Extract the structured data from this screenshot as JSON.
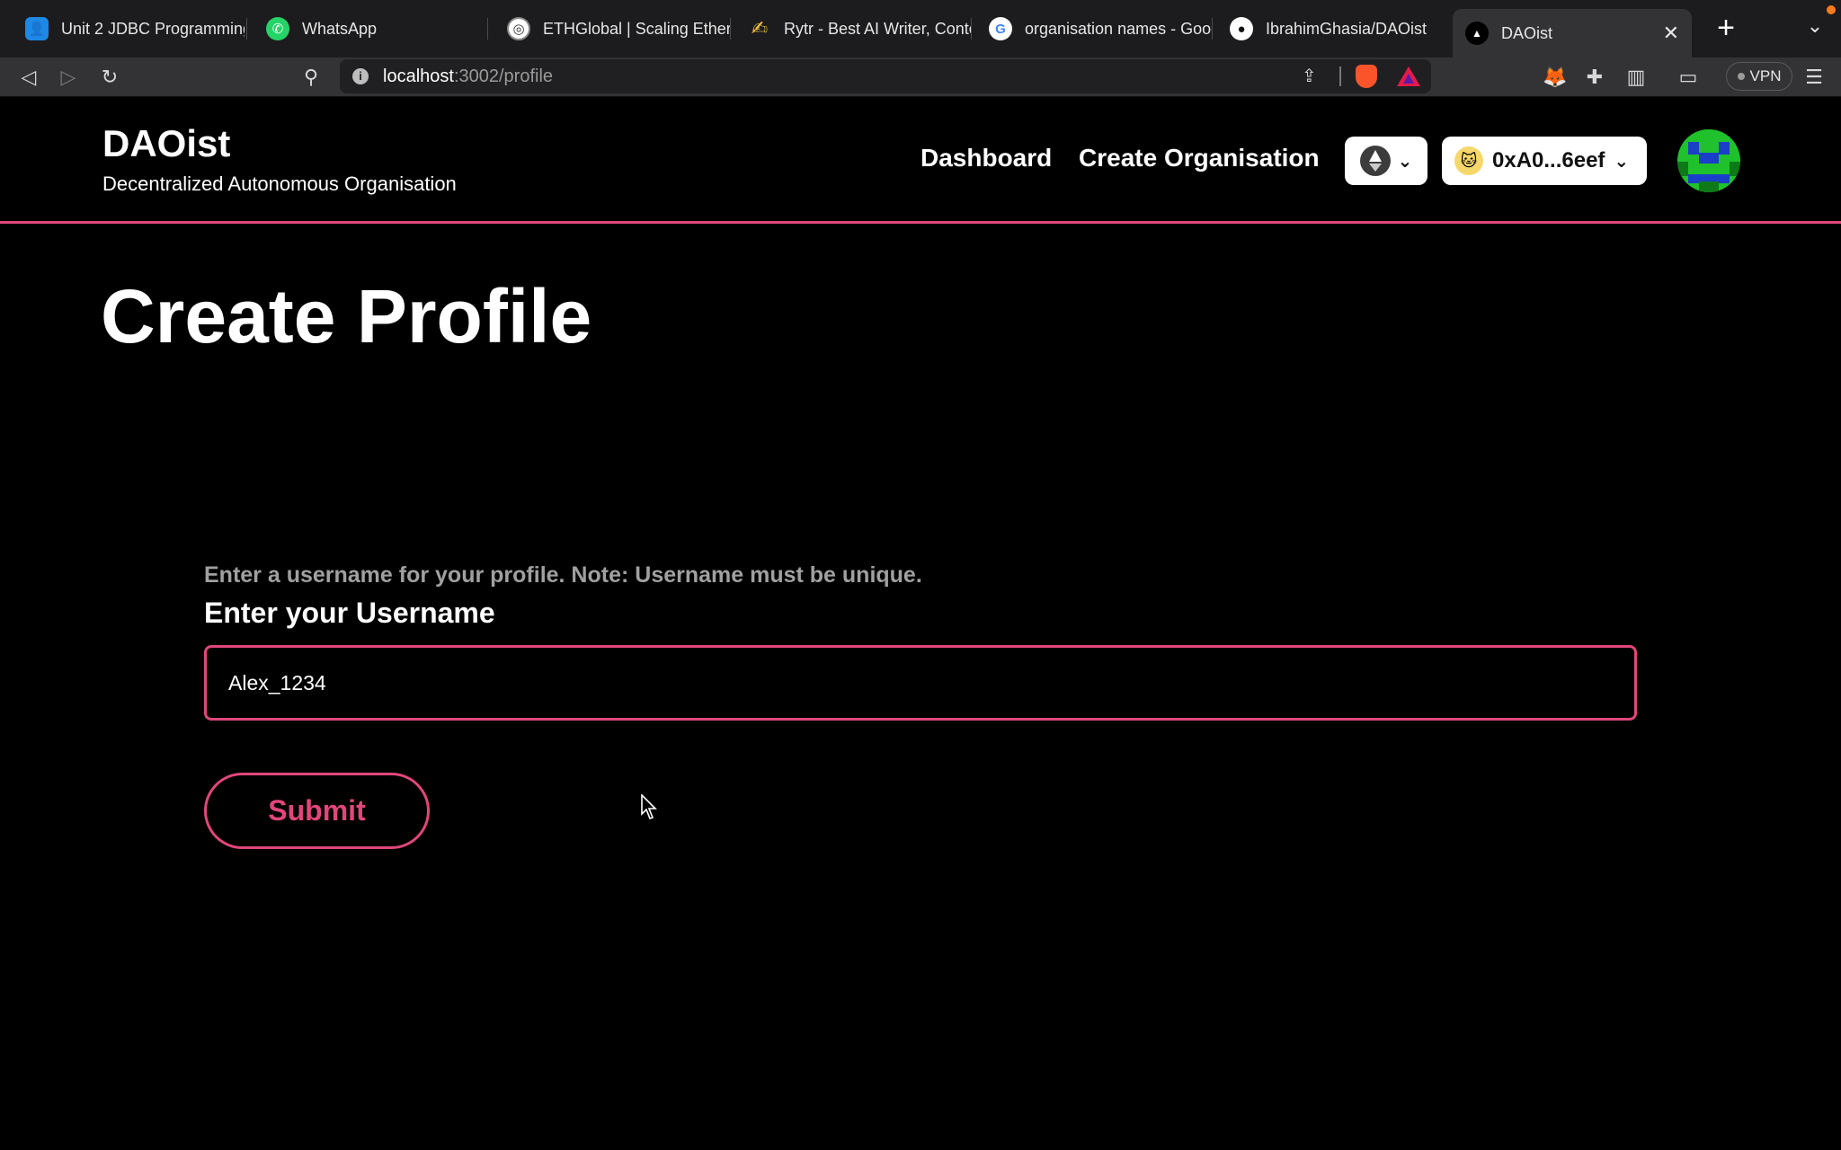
{
  "browser": {
    "tabs": [
      {
        "title": "Unit 2 JDBC Programming",
        "icon": "google-classroom-icon"
      },
      {
        "title": "WhatsApp",
        "icon": "whatsapp-icon"
      },
      {
        "title": "ETHGlobal | Scaling Ethere",
        "icon": "ethglobal-icon"
      },
      {
        "title": "Rytr - Best AI Writer, Conte",
        "icon": "rytr-icon"
      },
      {
        "title": "organisation names - Goog",
        "icon": "google-icon"
      },
      {
        "title": "IbrahimGhasia/DAOist",
        "icon": "github-icon"
      },
      {
        "title": "DAOist",
        "icon": "vercel-icon",
        "active": true
      }
    ],
    "url_host": "localhost",
    "url_path": ":3002/profile",
    "vpn_label": "VPN"
  },
  "header": {
    "brand": "DAOist",
    "tagline": "Decentralized Autonomous Organisation",
    "nav": {
      "dashboard": "Dashboard",
      "create_org": "Create Organisation"
    },
    "wallet": {
      "chain_icon": "ethereum-icon",
      "address": "0xA0...6eef"
    }
  },
  "main": {
    "title": "Create Profile",
    "hint": "Enter a username for your profile. Note: Username must be unique.",
    "field_label": "Enter your Username",
    "username_value": "Alex_1234",
    "submit_label": "Submit"
  },
  "colors": {
    "accent": "#e0467c",
    "background": "#000000",
    "hint_text": "#a0a0a0"
  }
}
